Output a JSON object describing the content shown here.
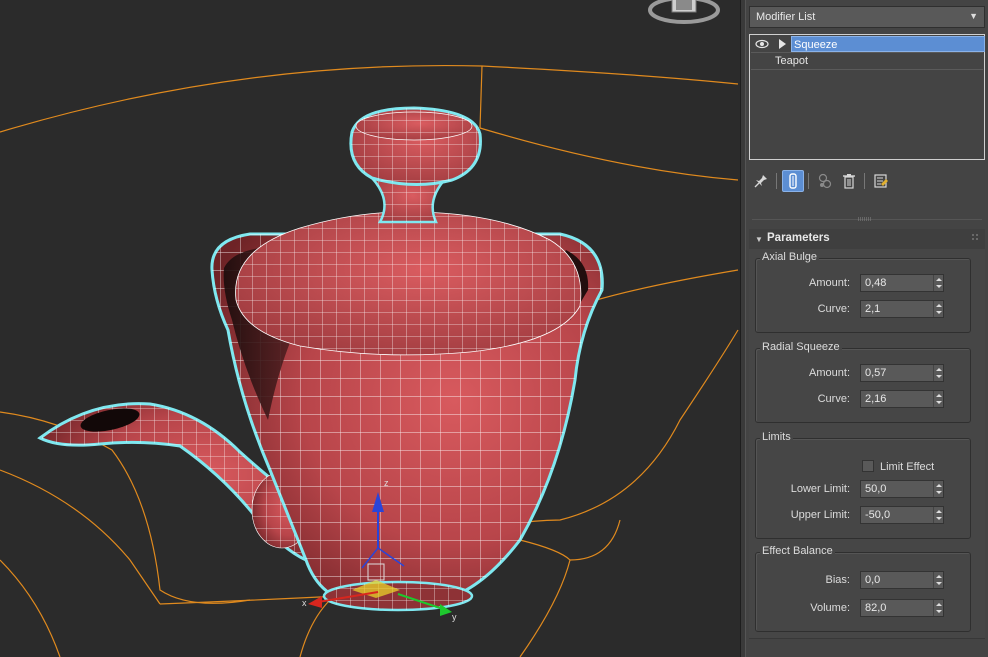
{
  "modifier_list": {
    "label": "Modifier List"
  },
  "stack": {
    "items": [
      {
        "label": "Squeeze",
        "selected": true
      },
      {
        "label": "Teapot",
        "selected": false
      }
    ]
  },
  "toolbar": {
    "icons": [
      "pin-stack-icon",
      "show-end-result-icon",
      "make-unique-icon",
      "remove-modifier-icon",
      "configure-modifier-sets-icon"
    ]
  },
  "rollout": {
    "title": "Parameters",
    "axial_bulge": {
      "title": "Axial Bulge",
      "amount_label": "Amount:",
      "amount": "0,48",
      "curve_label": "Curve:",
      "curve": "2,1"
    },
    "radial_squeeze": {
      "title": "Radial Squeeze",
      "amount_label": "Amount:",
      "amount": "0,57",
      "curve_label": "Curve:",
      "curve": "2,16"
    },
    "limits": {
      "title": "Limits",
      "limit_effect_label": "Limit Effect",
      "limit_effect_checked": false,
      "lower_label": "Lower Limit:",
      "lower": "50,0",
      "upper_label": "Upper Limit:",
      "upper": "-50,0"
    },
    "effect_balance": {
      "title": "Effect Balance",
      "bias_label": "Bias:",
      "bias": "0,0",
      "volume_label": "Volume:",
      "volume": "82,0"
    }
  },
  "colors": {
    "viewport_bg": "#2b2b2b",
    "gizmo_orange": "#e08a1e",
    "mesh_red": "#b8454a",
    "selection_cyan": "#7fe8f0",
    "selection_blue": "#5c8ed3",
    "panel_bg": "#444444"
  }
}
